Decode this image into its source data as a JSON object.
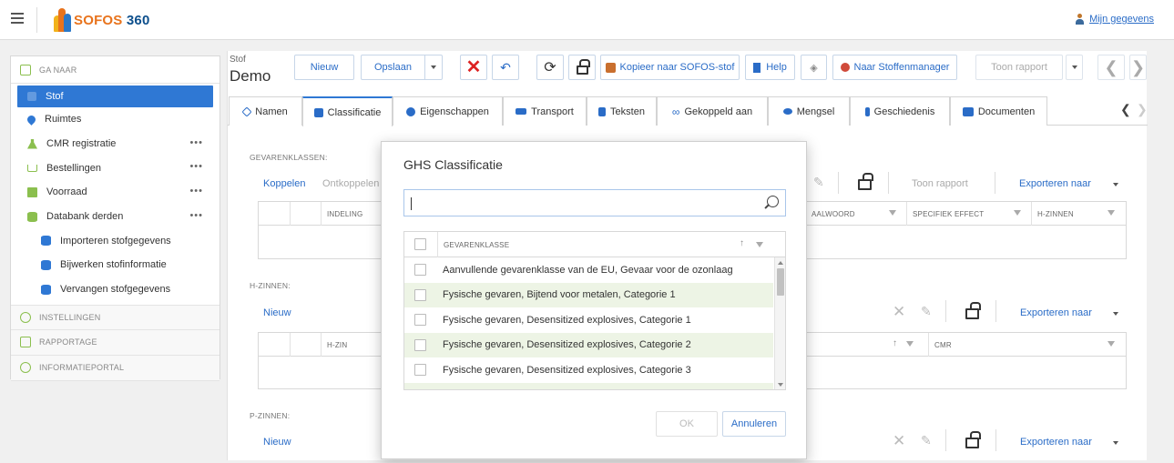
{
  "header": {
    "logo_text": "SOFOS",
    "logo_num": "360",
    "user_link": "Mijn gegevens"
  },
  "sidebar": {
    "goto_label": "GA NAAR",
    "items": [
      {
        "label": "Stof",
        "active": true
      },
      {
        "label": "Ruimtes"
      },
      {
        "label": "CMR registratie",
        "more": "•••"
      },
      {
        "label": "Bestellingen",
        "more": "•••"
      },
      {
        "label": "Voorraad",
        "more": "•••"
      },
      {
        "label": "Databank derden",
        "more": "•••"
      },
      {
        "label": "Importeren stofgegevens"
      },
      {
        "label": "Bijwerken stofinformatie"
      },
      {
        "label": "Vervangen stofgegevens"
      }
    ],
    "sections": [
      "INSTELLINGEN",
      "RAPPORTAGE",
      "INFORMATIEPORTAL"
    ]
  },
  "main": {
    "title_small": "Stof",
    "title": "Demo",
    "toolbar": {
      "new": "Nieuw",
      "save": "Opslaan",
      "copy": "Kopieer naar SOFOS-stof",
      "help": "Help",
      "to_manager": "Naar Stoffenmanager",
      "report": "Toon rapport"
    },
    "tabs": [
      "Namen",
      "Classificatie",
      "Eigenschappen",
      "Transport",
      "Teksten",
      "Gekoppeld aan",
      "Mengsel",
      "Geschiedenis",
      "Documenten"
    ],
    "gevarenklassen": {
      "label": "GEVARENKLASSEN:",
      "link_connect": "Koppelen",
      "link_disconnect": "Ontkoppelen",
      "report": "Toon rapport",
      "export": "Exporteren naar",
      "columns": [
        "INDELING",
        "AALWOORD",
        "SPECIFIEK EFFECT",
        "H-ZINNEN"
      ]
    },
    "hzinnen": {
      "label": "H-ZINNEN:",
      "link_new": "Nieuw",
      "export": "Exporteren naar",
      "columns": [
        "H-ZIN",
        "CMR"
      ]
    },
    "pzinnen": {
      "label": "P-ZINNEN:",
      "link_new": "Nieuw",
      "export": "Exporteren naar"
    }
  },
  "modal": {
    "title": "GHS Classificatie",
    "search_value": "",
    "column": "GEVARENKLASSE",
    "rows": [
      "Aanvullende gevarenklasse van de EU, Gevaar voor de ozonlaag",
      "Fysische gevaren, Bijtend voor metalen, Categorie 1",
      "Fysische gevaren, Desensitized explosives, Categorie 1",
      "Fysische gevaren, Desensitized explosives, Categorie 2",
      "Fysische gevaren, Desensitized explosives, Categorie 3"
    ],
    "ok": "OK",
    "cancel": "Annuleren"
  }
}
